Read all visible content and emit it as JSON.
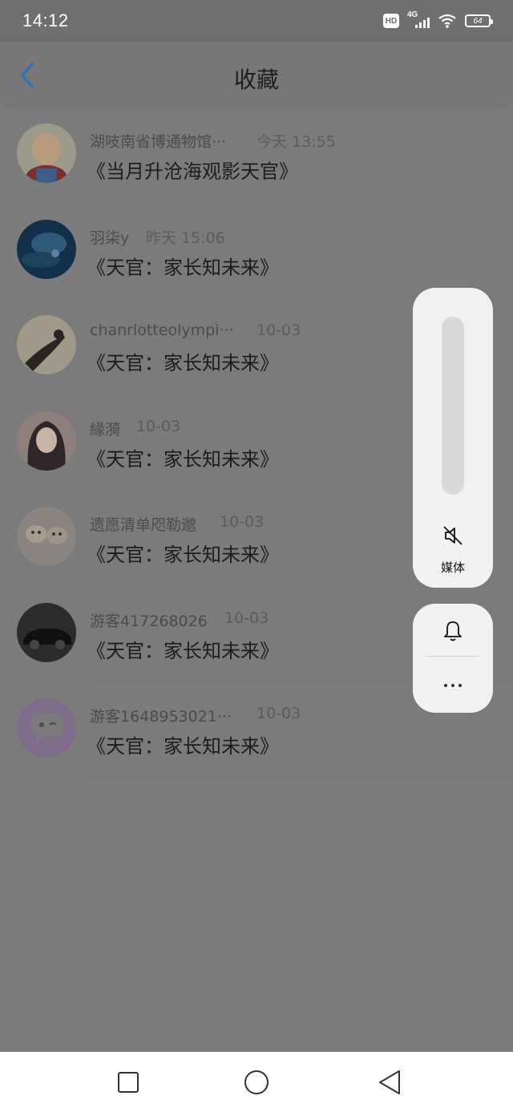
{
  "status_bar": {
    "time": "14:12",
    "hd_label": "HD",
    "network_label": "4G",
    "battery_level": "64"
  },
  "header": {
    "title": "收藏",
    "accent_color": "#1e6fb8"
  },
  "items": [
    {
      "author": "湖吱南省博通物馆···",
      "date": "今天 13:55",
      "title": "《当月升沧海观影天官》",
      "avatar": "baby-avatar"
    },
    {
      "author": "羽柒y",
      "date": "昨天 15:06",
      "title": "《天官：家长知未来》",
      "avatar": "blue-scene-avatar"
    },
    {
      "author": "chanrlotteolympi···",
      "date": "10-03",
      "title": "《天官：家长知未来》",
      "avatar": "silhouette-avatar"
    },
    {
      "author": "緣漪",
      "date": "10-03",
      "title": "《天官：家长知未来》",
      "avatar": "girl-avatar"
    },
    {
      "author": "遗愿清单咫勒邈",
      "date": "10-03",
      "title": "《天官：家长知未来》",
      "avatar": "kittens-avatar"
    },
    {
      "author": "游客417268026",
      "date": "10-03",
      "title": "《天官：家长知未来》",
      "avatar": "car-avatar"
    },
    {
      "author": "游客1648953021···",
      "date": "10-03",
      "title": "《天官：家长知未来》",
      "avatar": "default-chat-avatar"
    }
  ],
  "volume_panel": {
    "label": "媒体",
    "level": 0
  }
}
